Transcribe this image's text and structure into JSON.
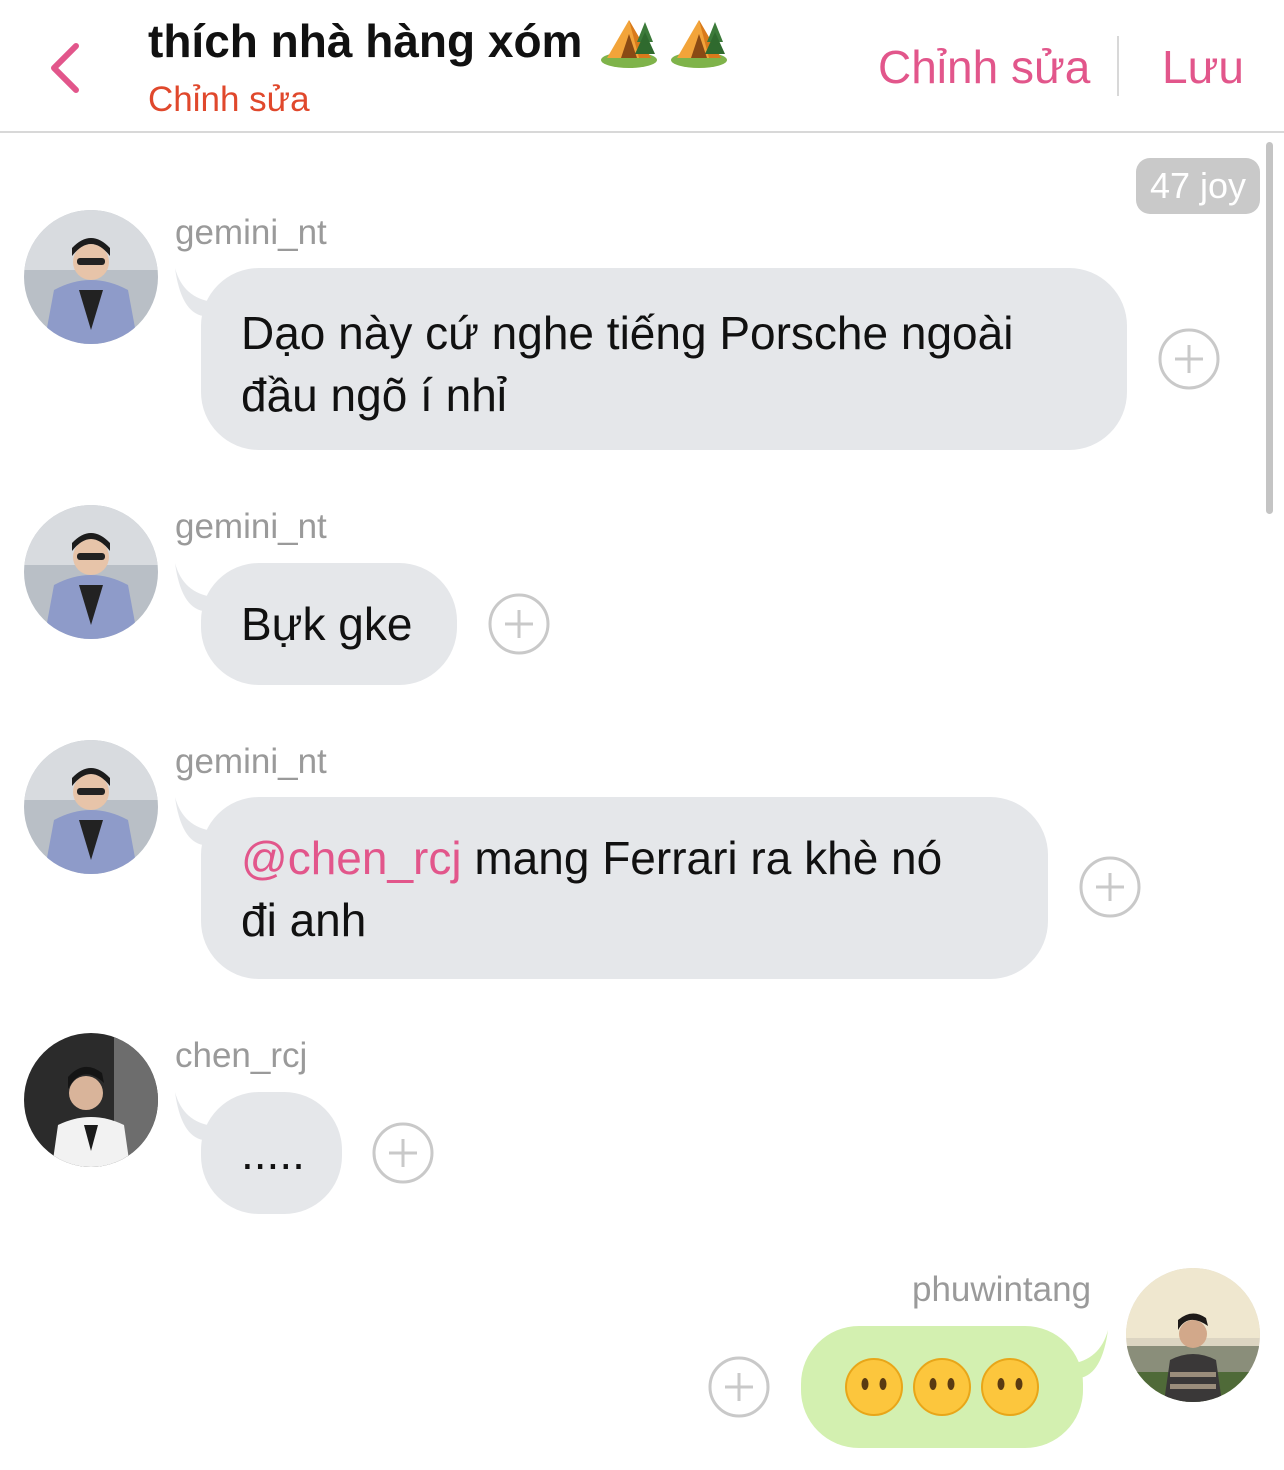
{
  "header": {
    "title": "thích nhà hàng xóm",
    "title_emoji": [
      "camping-tent-icon",
      "camping-tent-icon"
    ],
    "subtitle": "Chỉnh sửa",
    "edit_label": "Chỉnh sửa",
    "save_label": "Lưu"
  },
  "colors": {
    "accent": "#e2568b",
    "subtitle": "#e0482c",
    "bubble_incoming": "#e5e7ea",
    "bubble_outgoing": "#d3f0b0",
    "username": "#9a9a9a"
  },
  "joy_badge": "47 joy",
  "messages": [
    {
      "user": "gemini_nt",
      "text": "Dạo này cứ nghe tiếng Porsche ngoài đầu ngõ í nhỉ",
      "line1": "Dạo này cứ nghe tiếng Porsche ngoài",
      "line2": "đầu ngõ í nhỉ"
    },
    {
      "user": "gemini_nt",
      "text": "Bựk gke"
    },
    {
      "user": "gemini_nt",
      "mention": "@chen_rcj",
      "line1_rest": " mang Ferrari ra khè nó",
      "line2": "đi anh"
    },
    {
      "user": "chen_rcj",
      "text": "....."
    },
    {
      "user": "phuwintang",
      "emoji": [
        "face-without-mouth-icon",
        "face-without-mouth-icon",
        "face-without-mouth-icon"
      ]
    }
  ]
}
